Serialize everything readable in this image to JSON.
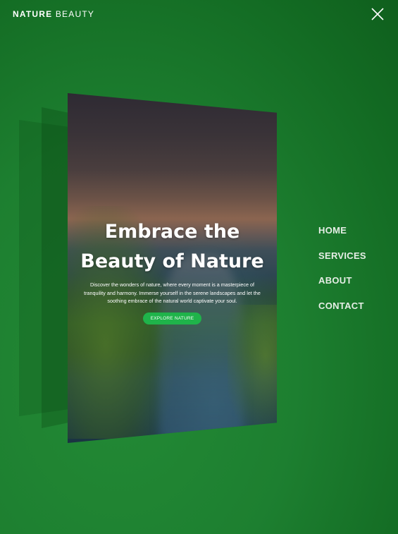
{
  "brand": {
    "bold": "NATURE",
    "light": " BEAUTY"
  },
  "hero": {
    "title_line1": "Embrace the",
    "title_line2": "Beauty of Nature",
    "description": "Discover the wonders of nature, where every moment is a masterpiece of tranquility and harmony. Immerse yourself in the serene landscapes and let the soothing embrace of the natural world captivate your soul.",
    "cta_label": "EXPLORE NATURE"
  },
  "nav": {
    "items": [
      {
        "label": "HOME"
      },
      {
        "label": "SERVICES"
      },
      {
        "label": "ABOUT"
      },
      {
        "label": "CONTACT"
      }
    ]
  },
  "icons": {
    "close": "close-icon"
  },
  "colors": {
    "background": "#1b7a2e",
    "accent": "#1fb34a",
    "text": "#ffffff"
  }
}
